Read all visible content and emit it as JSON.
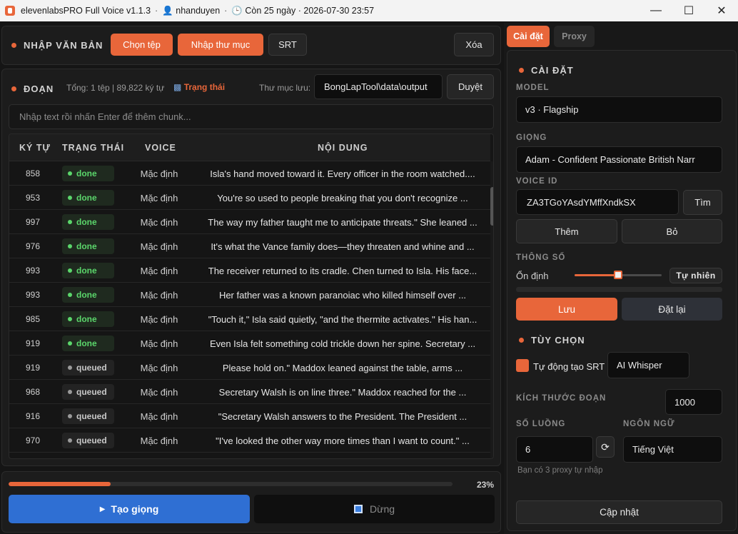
{
  "titlebar": {
    "app_name": "elevenlabsPRO Full Voice v1.1.3",
    "user": "nhanduyen",
    "license": "Còn 25 ngày · 2026-07-30 23:57",
    "minimize": "—",
    "maximize": "☐",
    "close": "✕"
  },
  "input_section": {
    "title": "NHẬP VĂN BẢN",
    "choose_file": "Chọn tệp",
    "import_folder": "Nhập thư mục",
    "srt": "SRT",
    "clear": "Xóa"
  },
  "chunks_section": {
    "title": "ĐOẠN",
    "summary": "Tổng: 1 tệp | 89,822 ký tự",
    "status_link": "Trạng thái",
    "output_label": "Thư mục lưu:",
    "output_path": "BongLapTool\\data\\output",
    "browse": "Duyệt",
    "chunk_placeholder": "Nhập text rồi nhấn Enter để thêm chunk..."
  },
  "table": {
    "headers": [
      "KÝ TỰ",
      "TRẠNG THÁI",
      "VOICE",
      "NỘI DUNG"
    ],
    "rows": [
      {
        "chars": "858",
        "status": "done",
        "voice": "Mặc định",
        "text": "Isla's hand moved toward it. Every officer in the room watched...."
      },
      {
        "chars": "953",
        "status": "done",
        "voice": "Mặc định",
        "text": "You're so used to people breaking that you don't recognize ..."
      },
      {
        "chars": "997",
        "status": "done",
        "voice": "Mặc định",
        "text": "The way my father taught me to anticipate threats.\" She leaned ..."
      },
      {
        "chars": "976",
        "status": "done",
        "voice": "Mặc định",
        "text": "It's what the Vance family does—they threaten and whine and ..."
      },
      {
        "chars": "993",
        "status": "done",
        "voice": "Mặc định",
        "text": "The receiver returned to its cradle. Chen turned to Isla. His face..."
      },
      {
        "chars": "993",
        "status": "done",
        "voice": "Mặc định",
        "text": "Her father was a known paranoiac who killed himself over ..."
      },
      {
        "chars": "985",
        "status": "done",
        "voice": "Mặc định",
        "text": "\"Touch it,\" Isla said quietly, \"and the thermite activates.\" His han..."
      },
      {
        "chars": "919",
        "status": "done",
        "voice": "Mặc định",
        "text": "Even Isla felt something cold trickle down her spine. Secretary ..."
      },
      {
        "chars": "919",
        "status": "queued",
        "voice": "Mặc định",
        "text": "Please hold on.\" Maddox leaned against the table, arms ..."
      },
      {
        "chars": "968",
        "status": "queued",
        "voice": "Mặc định",
        "text": "Secretary Walsh is on line three.\" Maddox reached for the ..."
      },
      {
        "chars": "916",
        "status": "queued",
        "voice": "Mặc định",
        "text": "\"Secretary Walsh answers to the President. The President ..."
      },
      {
        "chars": "970",
        "status": "queued",
        "voice": "Mặc định",
        "text": "\"I've looked the other way more times than I want to count.\" ..."
      }
    ]
  },
  "bottom": {
    "progress": 0.23,
    "progress_text": "23%",
    "generate": "Tạo giọng",
    "stop": "Dừng"
  },
  "tabs": [
    "Cài đặt",
    "Proxy"
  ],
  "settings": {
    "title": "CÀI ĐẶT",
    "model_label": "MODEL",
    "model_value": "v3 · Flagship",
    "voice_label": "GIỌNG",
    "voice_value": "Adam - Confident Passionate British Narr",
    "voice_id_label": "VOICE ID",
    "voice_id_value": "ZA3TGoYAsdYMffXndkSX",
    "find": "Tìm",
    "add": "Thêm",
    "remove": "Bỏ",
    "params_label": "THÔNG SỐ",
    "stability_label": "Ổn định",
    "stability_value": 0.5,
    "stability_mode": "Tự nhiên",
    "save": "Lưu",
    "reset": "Đặt lại"
  },
  "options": {
    "title": "TÙY CHỌN",
    "auto_srt_label": "Tự động tạo SRT",
    "auto_srt_checked": true,
    "srt_engine": "AI Whisper",
    "chunk_size_label": "KÍCH THƯỚC ĐOẠN",
    "chunk_size_value": "1000",
    "threads_label": "SỐ LUỒNG",
    "threads_value": "6",
    "language_label": "NGÔN NGỮ",
    "language_value": "Tiếng Việt",
    "proxy_note": "Bạn có 3 proxy tự nhập",
    "update": "Cập nhật"
  },
  "colors": {
    "accent": "#e8663a",
    "primary": "#2f6fd3",
    "done": "#5bd66b"
  }
}
